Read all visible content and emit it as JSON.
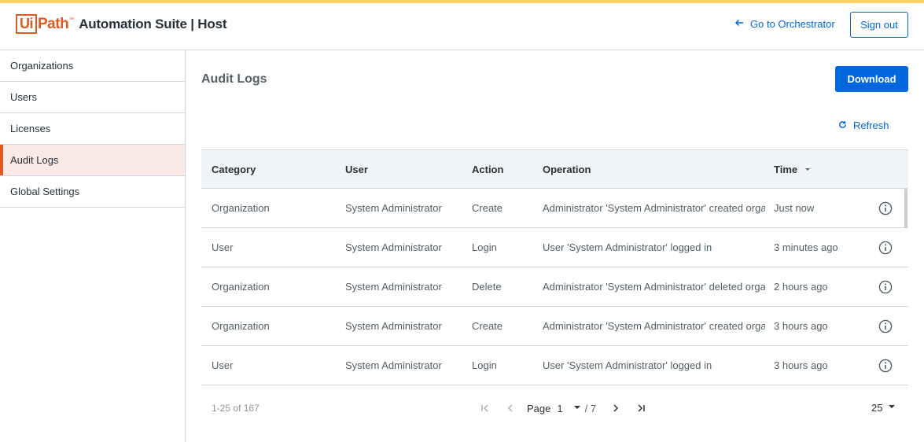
{
  "brand": {
    "logo_ui": "Ui",
    "logo_path": "Path",
    "logo_tm": "™",
    "product": "Automation Suite | Host"
  },
  "header": {
    "go_to_orchestrator": "Go to Orchestrator",
    "sign_out": "Sign out"
  },
  "sidebar": {
    "items": [
      {
        "label": "Organizations"
      },
      {
        "label": "Users"
      },
      {
        "label": "Licenses"
      },
      {
        "label": "Audit Logs",
        "active": true
      },
      {
        "label": "Global Settings"
      }
    ]
  },
  "main": {
    "title": "Audit Logs",
    "download": "Download",
    "refresh": "Refresh"
  },
  "table": {
    "columns": [
      "Category",
      "User",
      "Action",
      "Operation",
      "Time"
    ],
    "sorted_column": "Time",
    "rows": [
      {
        "category": "Organization",
        "user": "System Administrator",
        "action": "Create",
        "operation": "Administrator 'System Administrator' created organ",
        "time": "Just now"
      },
      {
        "category": "User",
        "user": "System Administrator",
        "action": "Login",
        "operation": "User 'System Administrator' logged in",
        "time": "3 minutes ago"
      },
      {
        "category": "Organization",
        "user": "System Administrator",
        "action": "Delete",
        "operation": "Administrator 'System Administrator' deleted organ",
        "time": "2 hours ago"
      },
      {
        "category": "Organization",
        "user": "System Administrator",
        "action": "Create",
        "operation": "Administrator 'System Administrator' created organ",
        "time": "3 hours ago"
      },
      {
        "category": "User",
        "user": "System Administrator",
        "action": "Login",
        "operation": "User 'System Administrator' logged in",
        "time": "3 hours ago"
      }
    ]
  },
  "pagination": {
    "range": "1-25 of 167",
    "page_label": "Page",
    "current_page": "1",
    "total_pages": "/ 7",
    "page_size": "25"
  },
  "colors": {
    "accent": "#fad165",
    "brand": "#e05a22",
    "primary": "#0067df",
    "active_nav_bg": "#fbe9e5"
  }
}
